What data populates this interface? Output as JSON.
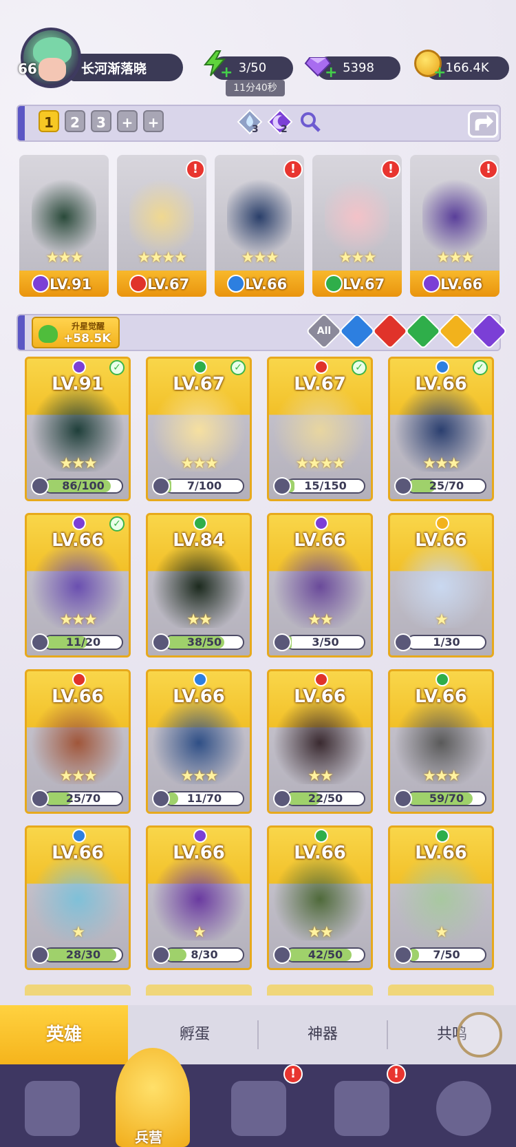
{
  "player": {
    "level": "66",
    "name": "长河渐落晓"
  },
  "resources": {
    "energy": "3/50",
    "energy_timer": "11分40秒",
    "gems": "5398",
    "gold": "166.4K"
  },
  "team_tabs": [
    "1",
    "2",
    "3",
    "+",
    "+"
  ],
  "team_counts": {
    "water_count": "3",
    "dark_count": "2"
  },
  "team_heroes": [
    {
      "level": "LV.91",
      "element": "dark",
      "stars": "★★★",
      "alert": false
    },
    {
      "level": "LV.67",
      "element": "fire",
      "stars": "★★★★",
      "alert": true
    },
    {
      "level": "LV.66",
      "element": "water",
      "stars": "★★★",
      "alert": true
    },
    {
      "level": "LV.67",
      "element": "wind",
      "stars": "★★★",
      "alert": true
    },
    {
      "level": "LV.66",
      "element": "dark",
      "stars": "★★★",
      "alert": true
    }
  ],
  "upstar": {
    "title": "升星觉醒",
    "value": "+58.5K"
  },
  "filters": [
    "All",
    "water",
    "fire",
    "wind",
    "light",
    "dark"
  ],
  "heroes": [
    {
      "level": "LV.91",
      "element": "dark",
      "stars": "★★★",
      "progress": "86/100",
      "ratio": 0.86,
      "checked": true
    },
    {
      "level": "LV.67",
      "element": "wind",
      "stars": "★★★",
      "progress": "7/100",
      "ratio": 0.07,
      "checked": true
    },
    {
      "level": "LV.67",
      "element": "fire",
      "stars": "★★★★",
      "progress": "15/150",
      "ratio": 0.1,
      "checked": true
    },
    {
      "level": "LV.66",
      "element": "water",
      "stars": "★★★",
      "progress": "25/70",
      "ratio": 0.36,
      "checked": true
    },
    {
      "level": "LV.66",
      "element": "dark",
      "stars": "★★★",
      "progress": "11/20",
      "ratio": 0.55,
      "checked": true
    },
    {
      "level": "LV.84",
      "element": "wind",
      "stars": "★★",
      "progress": "38/50",
      "ratio": 0.76,
      "checked": false
    },
    {
      "level": "LV.66",
      "element": "dark",
      "stars": "★★",
      "progress": "3/50",
      "ratio": 0.06,
      "checked": false
    },
    {
      "level": "LV.66",
      "element": "light",
      "stars": "★",
      "progress": "1/30",
      "ratio": 0.03,
      "checked": false
    },
    {
      "level": "LV.66",
      "element": "fire",
      "stars": "★★★",
      "progress": "25/70",
      "ratio": 0.36,
      "checked": false
    },
    {
      "level": "LV.66",
      "element": "water",
      "stars": "★★★",
      "progress": "11/70",
      "ratio": 0.16,
      "checked": false
    },
    {
      "level": "LV.66",
      "element": "fire",
      "stars": "★★",
      "progress": "22/50",
      "ratio": 0.44,
      "checked": false
    },
    {
      "level": "LV.66",
      "element": "wind",
      "stars": "★★★",
      "progress": "59/70",
      "ratio": 0.84,
      "checked": false
    },
    {
      "level": "LV.66",
      "element": "water",
      "stars": "★",
      "progress": "28/30",
      "ratio": 0.93,
      "checked": false
    },
    {
      "level": "LV.66",
      "element": "dark",
      "stars": "★",
      "progress": "8/30",
      "ratio": 0.27,
      "checked": false
    },
    {
      "level": "LV.66",
      "element": "wind",
      "stars": "★★",
      "progress": "42/50",
      "ratio": 0.84,
      "checked": false
    },
    {
      "level": "LV.66",
      "element": "wind",
      "stars": "★",
      "progress": "7/50",
      "ratio": 0.14,
      "checked": false
    }
  ],
  "sub_tabs": [
    "英雄",
    "孵蛋",
    "神器",
    "共鸣"
  ],
  "nav": {
    "center_label": "兵营"
  },
  "colors": {
    "dark": "#7b3fd6",
    "fire": "#e0332a",
    "water": "#2d7fe0",
    "wind": "#2fae4a",
    "light": "#f2b21c",
    "accent": "#5b57c4"
  }
}
